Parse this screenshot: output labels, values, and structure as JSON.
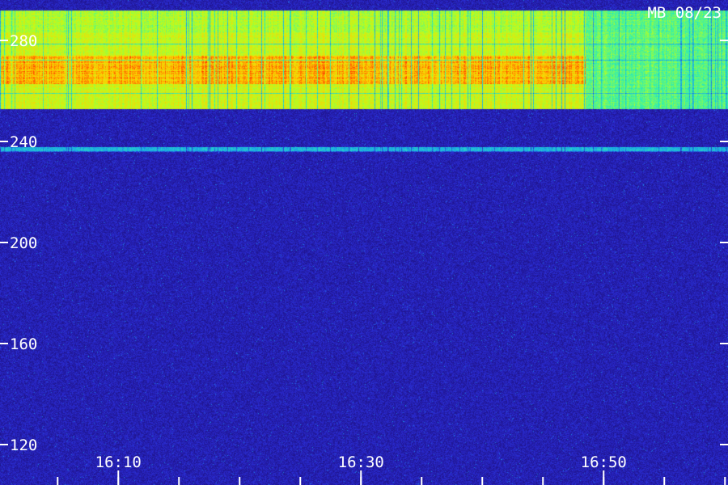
{
  "chart_data": {
    "type": "heatmap",
    "title": "MB 08/23",
    "y_ticks": [
      "120",
      "160",
      "200",
      "240",
      "280"
    ],
    "y_tick_values": [
      120,
      160,
      200,
      240,
      280
    ],
    "ylim": [
      104,
      296
    ],
    "x_ticks": [
      "16:10",
      "16:30",
      "16:50"
    ],
    "x_tick_values": [
      "16:10",
      "16:30",
      "16:50"
    ],
    "x_tick_minutes": [
      10,
      30,
      50
    ],
    "xlim_minutes": [
      0.25,
      60.25
    ],
    "minor_tick_interval_minutes": 5,
    "colormap": [
      "#1a0a6e",
      "#2a2ad0",
      "#18a8e8",
      "#30f0b0",
      "#b8ff20",
      "#ffd000",
      "#ff3000"
    ],
    "intensity_bands": [
      {
        "freq_range": [
          253,
          263
        ],
        "time_range": [
          0.25,
          48.5
        ],
        "level": 0.78
      },
      {
        "freq_range": [
          263,
          274
        ],
        "time_range": [
          0.25,
          48.5
        ],
        "level": 0.93
      },
      {
        "freq_range": [
          274,
          283
        ],
        "time_range": [
          0.25,
          48.5
        ],
        "level": 0.75
      },
      {
        "freq_range": [
          283,
          292
        ],
        "time_range": [
          0.25,
          48.5
        ],
        "level": 0.72
      },
      {
        "freq_range": [
          253,
          292
        ],
        "time_range": [
          48.5,
          60.25
        ],
        "level": 0.6
      },
      {
        "freq_range": [
          236,
          238
        ],
        "time_range": [
          0.25,
          60.25
        ],
        "level": 0.4
      }
    ]
  }
}
